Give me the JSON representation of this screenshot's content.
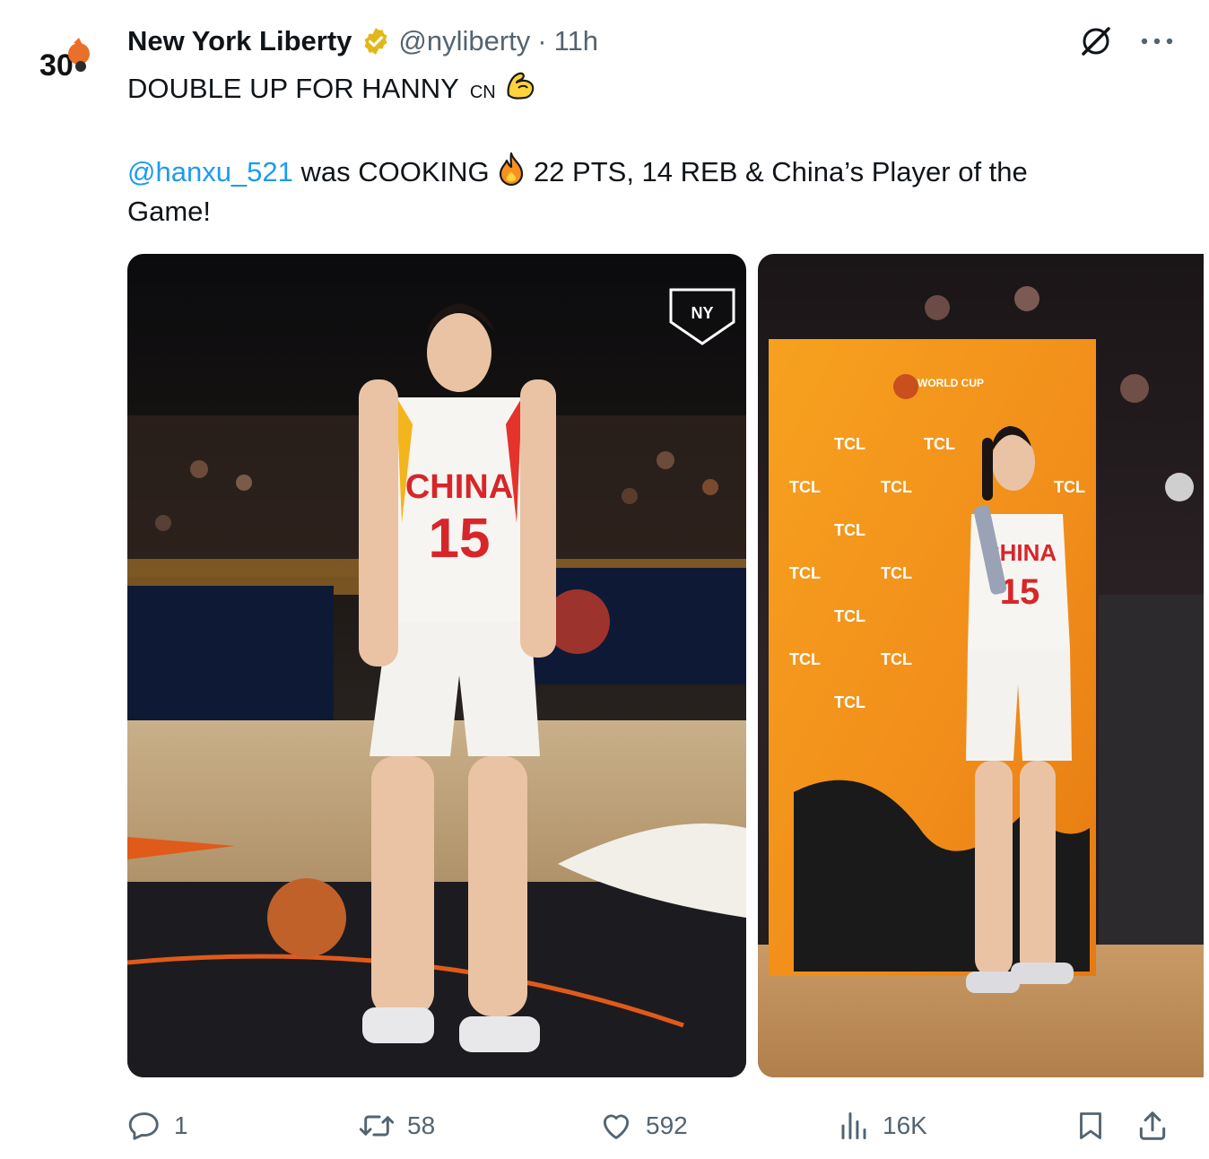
{
  "tweet": {
    "display_name": "New York Liberty",
    "handle": "@nyliberty",
    "separator": "·",
    "time": "11h",
    "line1": "DOUBLE UP FOR HANNY",
    "flag": "CN",
    "mention": "@hanxu_521",
    "line2_a": "was COOKING",
    "line2_b": "22 PTS, 14 REB & China’s Player of the",
    "line3": "Game!"
  },
  "avatar": {
    "badge_text": "30"
  },
  "media": {
    "jersey_team": "CHINA",
    "jersey_number": "15",
    "sponsor": "TCL",
    "backdrop_title": "WORLD CUP",
    "watermark": "NY"
  },
  "actions": {
    "replies": "1",
    "reposts": "58",
    "likes": "592",
    "views": "16K"
  },
  "colors": {
    "link": "#1d9bf0",
    "muted": "#536471",
    "verified": "#e2b719",
    "backdrop": "#f39a1c"
  },
  "icons": [
    "grok-icon",
    "more-icon",
    "reply-icon",
    "repost-icon",
    "like-icon",
    "views-icon",
    "bookmark-icon",
    "share-icon",
    "verified-icon",
    "flexed-bicep-icon",
    "fire-icon"
  ]
}
